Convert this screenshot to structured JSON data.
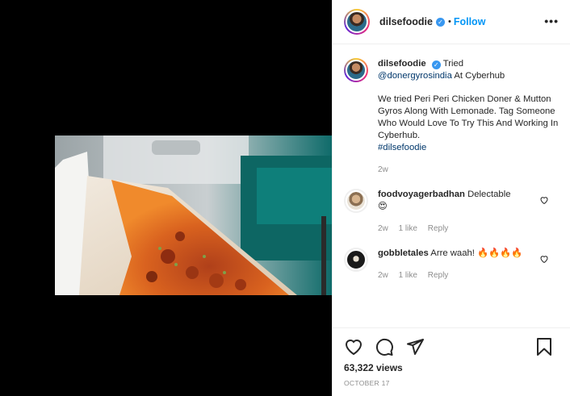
{
  "post": {
    "username": "dilsefoodie",
    "follow_label": "Follow",
    "separator": "•",
    "more_label": "•••"
  },
  "caption": {
    "username": "dilsefoodie",
    "lead": "Tried",
    "mention": "@donergyrosindia",
    "lead_tail": "At Cyberhub",
    "body": "We tried Peri Peri Chicken Doner & Mutton Gyros Along With Lemonade. Tag Someone Who Would Love To Try This And Working In Cyberhub.",
    "hashtag": "#dilsefoodie",
    "age": "2w"
  },
  "comments": [
    {
      "username": "foodvoyagerbadhan",
      "text": "Delectable",
      "emoji": "😍",
      "age": "2w",
      "likes": "1 like",
      "reply": "Reply"
    },
    {
      "username": "gobbletales",
      "text": "Arre waah!",
      "emoji": "🔥🔥🔥🔥",
      "age": "2w",
      "likes": "1 like",
      "reply": "Reply"
    }
  ],
  "stats": {
    "views": "63,322 views",
    "date": "OCTOBER 17"
  },
  "icons": {
    "like": "heart-icon",
    "comment": "comment-icon",
    "share": "share-icon",
    "save": "bookmark-icon",
    "verified": "verified-badge-icon"
  },
  "colors": {
    "accent": "#0095f6",
    "verified": "#3897f0",
    "muted": "#8e8e8e",
    "link": "#00376b"
  }
}
